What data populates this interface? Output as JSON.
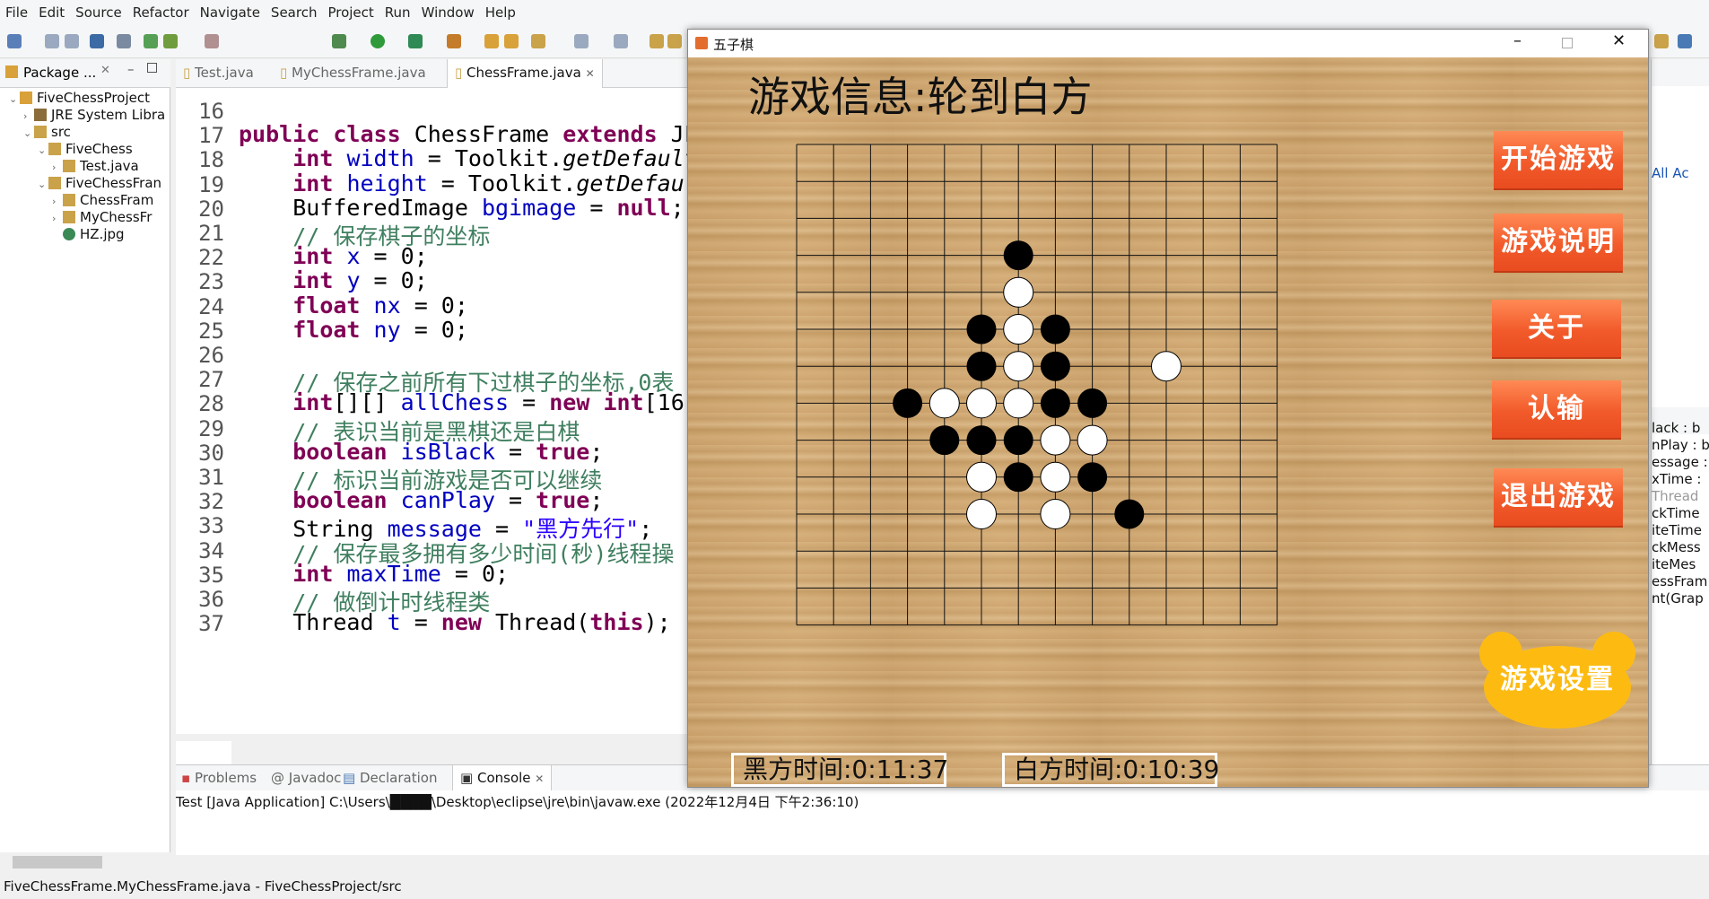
{
  "menu": [
    "File",
    "Edit",
    "Source",
    "Refactor",
    "Navigate",
    "Search",
    "Project",
    "Run",
    "Window",
    "Help"
  ],
  "package_explorer": {
    "tab_label": "Package ...",
    "tree": [
      {
        "label": "FiveChessProject",
        "depth": 0
      },
      {
        "label": "JRE System Libra",
        "depth": 1
      },
      {
        "label": "src",
        "depth": 1
      },
      {
        "label": "FiveChess",
        "depth": 2
      },
      {
        "label": "Test.java",
        "depth": 3
      },
      {
        "label": "FiveChessFran",
        "depth": 2
      },
      {
        "label": "ChessFram",
        "depth": 3
      },
      {
        "label": "MyChessFr",
        "depth": 3
      },
      {
        "label": "HZ.jpg",
        "depth": 3
      }
    ]
  },
  "editor": {
    "tabs": [
      "Test.java",
      "MyChessFrame.java",
      "ChessFrame.java"
    ],
    "active_tab": "ChessFrame.java",
    "lines": [
      {
        "n": "16",
        "t": ""
      },
      {
        "n": "17",
        "t": "public class ChessFrame extends JF"
      },
      {
        "n": "18",
        "t": "    int width = Toolkit.getDefault"
      },
      {
        "n": "19",
        "t": "    int height = Toolkit.getDefau"
      },
      {
        "n": "20",
        "t": "    BufferedImage bgimage = null;"
      },
      {
        "n": "21",
        "t": "    // 保存棋子的坐标"
      },
      {
        "n": "22",
        "t": "    int x = 0;"
      },
      {
        "n": "23",
        "t": "    int y = 0;"
      },
      {
        "n": "24",
        "t": "    float nx = 0;"
      },
      {
        "n": "25",
        "t": "    float ny = 0;"
      },
      {
        "n": "26",
        "t": ""
      },
      {
        "n": "27",
        "t": "    // 保存之前所有下过棋子的坐标,0表"
      },
      {
        "n": "28",
        "t": "    int[][] allChess = new int[16]"
      },
      {
        "n": "29",
        "t": "    // 表识当前是黑棋还是白棋"
      },
      {
        "n": "30",
        "t": "    boolean isBlack = true;"
      },
      {
        "n": "31",
        "t": "    // 标识当前游戏是否可以继续"
      },
      {
        "n": "32",
        "t": "    boolean canPlay = true;"
      },
      {
        "n": "33",
        "t": "    String message = \"黑方先行\";"
      },
      {
        "n": "34",
        "t": "    // 保存最多拥有多少时间(秒)线程操"
      },
      {
        "n": "35",
        "t": "    int maxTime = 0;"
      },
      {
        "n": "36",
        "t": "    // 做倒计时线程类"
      },
      {
        "n": "37",
        "t": "    Thread t = new Thread(this);"
      }
    ]
  },
  "bottom_panel": {
    "tabs": [
      "Problems",
      "Javadoc",
      "Declaration",
      "Console"
    ],
    "active_tab": "Console",
    "console_line": "Test [Java Application] C:\\Users\\████\\Desktop\\eclipse\\jre\\bin\\javaw.exe (2022年12月4日 下午2:36:10)"
  },
  "right_outline": [
    "lack : b",
    "nPlay : b",
    "essage :",
    "xTime :",
    "Thread",
    "ckTime",
    "iteTime",
    "ckMess",
    "iteMes",
    "essFram",
    "nt(Grap"
  ],
  "right_misc": [
    "All",
    "Ac"
  ],
  "status_bar": "FiveChessFrame.MyChessFrame.java - FiveChessProject/src",
  "game": {
    "window_title": "五子棋",
    "info_text": "游戏信息:轮到白方",
    "buttons": [
      "开始游戏",
      "游戏说明",
      "关于",
      "认输",
      "退出游戏"
    ],
    "settings_button": "游戏设置",
    "black_time": "黑方时间:0:11:37",
    "white_time": "白方时间:0:10:39",
    "board_size": 13,
    "stones": [
      {
        "c": 6,
        "r": 3,
        "color": "black"
      },
      {
        "c": 6,
        "r": 4,
        "color": "white"
      },
      {
        "c": 5,
        "r": 5,
        "color": "black"
      },
      {
        "c": 6,
        "r": 5,
        "color": "white"
      },
      {
        "c": 7,
        "r": 5,
        "color": "black"
      },
      {
        "c": 5,
        "r": 6,
        "color": "black"
      },
      {
        "c": 6,
        "r": 6,
        "color": "white"
      },
      {
        "c": 7,
        "r": 6,
        "color": "black"
      },
      {
        "c": 10,
        "r": 6,
        "color": "white"
      },
      {
        "c": 3,
        "r": 7,
        "color": "black"
      },
      {
        "c": 4,
        "r": 7,
        "color": "white"
      },
      {
        "c": 5,
        "r": 7,
        "color": "white"
      },
      {
        "c": 6,
        "r": 7,
        "color": "white"
      },
      {
        "c": 7,
        "r": 7,
        "color": "black"
      },
      {
        "c": 8,
        "r": 7,
        "color": "black"
      },
      {
        "c": 4,
        "r": 8,
        "color": "black"
      },
      {
        "c": 5,
        "r": 8,
        "color": "black"
      },
      {
        "c": 6,
        "r": 8,
        "color": "black"
      },
      {
        "c": 7,
        "r": 8,
        "color": "white"
      },
      {
        "c": 8,
        "r": 8,
        "color": "white"
      },
      {
        "c": 5,
        "r": 9,
        "color": "white"
      },
      {
        "c": 6,
        "r": 9,
        "color": "black"
      },
      {
        "c": 7,
        "r": 9,
        "color": "white"
      },
      {
        "c": 8,
        "r": 9,
        "color": "black"
      },
      {
        "c": 5,
        "r": 10,
        "color": "white"
      },
      {
        "c": 7,
        "r": 10,
        "color": "white"
      },
      {
        "c": 9,
        "r": 10,
        "color": "black"
      }
    ]
  }
}
